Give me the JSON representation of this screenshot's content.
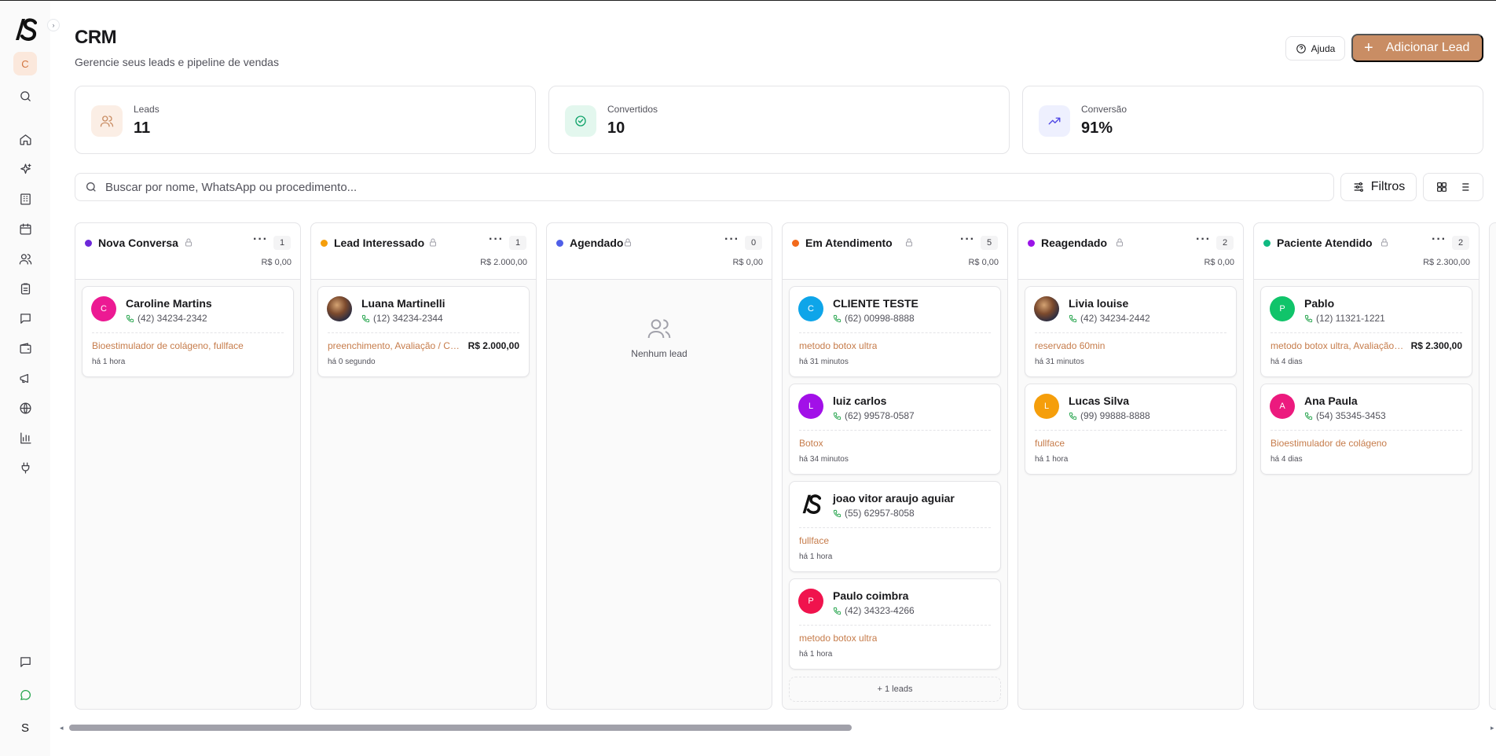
{
  "app": {
    "brand_icon": "app-logo-icon"
  },
  "sidebar": {
    "avatar_letter": "C",
    "items": [
      {
        "name": "search-icon"
      },
      {
        "name": "home-icon"
      },
      {
        "name": "sparkles-icon"
      },
      {
        "name": "building-icon"
      },
      {
        "name": "calendar-icon"
      },
      {
        "name": "users-icon"
      },
      {
        "name": "clipboard-icon"
      },
      {
        "name": "message-icon"
      },
      {
        "name": "wallet-icon"
      },
      {
        "name": "megaphone-icon"
      },
      {
        "name": "globe-icon"
      },
      {
        "name": "bar-chart-icon"
      },
      {
        "name": "plug-icon"
      }
    ],
    "bottom_letter": "S"
  },
  "header": {
    "title": "CRM",
    "subtitle": "Gerencie seus leads e pipeline de vendas",
    "help_label": "Ajuda",
    "add_lead_label": "Adicionar Lead",
    "accent": "#c98d64"
  },
  "stats": [
    {
      "label": "Leads",
      "value": "11",
      "icon": "users-icon"
    },
    {
      "label": "Convertidos",
      "value": "10",
      "icon": "check-circle-icon"
    },
    {
      "label": "Conversão",
      "value": "91%",
      "icon": "trending-up-icon"
    }
  ],
  "search": {
    "placeholder": "Buscar por nome, WhatsApp ou procedimento...",
    "value": ""
  },
  "filters_label": "Filtros",
  "columns": [
    {
      "title": "Nova Conversa",
      "color": "#6d28d9",
      "count": "1",
      "total": "R$ 0,00",
      "leads": [
        {
          "avatar": "C",
          "avatar_color": "#ec1a93",
          "name": "Caroline Martins",
          "phone": "(42) 34234-2342",
          "procedure": "Bioestimulador de colágeno, fullface",
          "value": "",
          "time": "há 1 hora"
        }
      ]
    },
    {
      "title": "Lead Interessado",
      "color": "#f59e0b",
      "count": "1",
      "total": "R$ 2.000,00",
      "leads": [
        {
          "avatar": "",
          "avatar_color": "photo",
          "name": "Luana Martinelli",
          "phone": "(12) 34234-2344",
          "procedure": "preenchimento, Avaliação / Consulta",
          "value": "R$ 2.000,00",
          "time": "há 0 segundo"
        }
      ]
    },
    {
      "title": "Agendado",
      "color": "#4f5fe8",
      "count": "0",
      "total": "R$ 0,00",
      "leads": [],
      "empty_text": "Nenhum lead"
    },
    {
      "title": "Em Atendimento",
      "color": "#f26a1b",
      "count": "5",
      "total": "R$ 0,00",
      "leads": [
        {
          "avatar": "C",
          "avatar_color": "#0ea5e9",
          "name": "CLIENTE TESTE",
          "phone": "(62) 00998-8888",
          "procedure": "metodo botox ultra",
          "value": "",
          "time": "há 31 minutos"
        },
        {
          "avatar": "L",
          "avatar_color": "#a210e8",
          "name": "luiz carlos",
          "phone": "(62) 99578-0587",
          "procedure": "Botox",
          "value": "",
          "time": "há 34 minutos"
        },
        {
          "avatar": "",
          "avatar_color": "logo",
          "name": "joao vitor araujo aguiar",
          "phone": "(55) 62957-8058",
          "procedure": "fullface",
          "value": "",
          "time": "há 1 hora"
        },
        {
          "avatar": "P",
          "avatar_color": "#f0134d",
          "name": "Paulo coimbra",
          "phone": "(42) 34323-4266",
          "procedure": "metodo botox ultra",
          "value": "",
          "time": "há 1 hora"
        }
      ],
      "more_label": "+ 1 leads"
    },
    {
      "title": "Reagendado",
      "color": "#9b14e8",
      "count": "2",
      "total": "R$ 0,00",
      "leads": [
        {
          "avatar": "",
          "avatar_color": "photo",
          "name": "Livia louise",
          "phone": "(42) 34234-2442",
          "procedure": "reservado 60min",
          "value": "",
          "time": "há 31 minutos"
        },
        {
          "avatar": "L",
          "avatar_color": "#f59e0b",
          "name": "Lucas Silva",
          "phone": "(99) 99888-8888",
          "procedure": "fullface",
          "value": "",
          "time": "há 1 hora"
        }
      ]
    },
    {
      "title": "Paciente Atendido",
      "color": "#10b981",
      "count": "2",
      "total": "R$ 2.300,00",
      "leads": [
        {
          "avatar": "P",
          "avatar_color": "#10c46a",
          "name": "Pablo",
          "phone": "(12) 11321-1221",
          "procedure": "metodo botox ultra, Avaliação / Consulta",
          "value": "R$ 2.300,00",
          "time": "há 4 dias"
        },
        {
          "avatar": "A",
          "avatar_color": "#ec1a7e",
          "name": "Ana Paula",
          "phone": "(54) 35345-3453",
          "procedure": "Bioestimulador de colágeno",
          "value": "",
          "time": "há 4 dias"
        }
      ]
    }
  ]
}
